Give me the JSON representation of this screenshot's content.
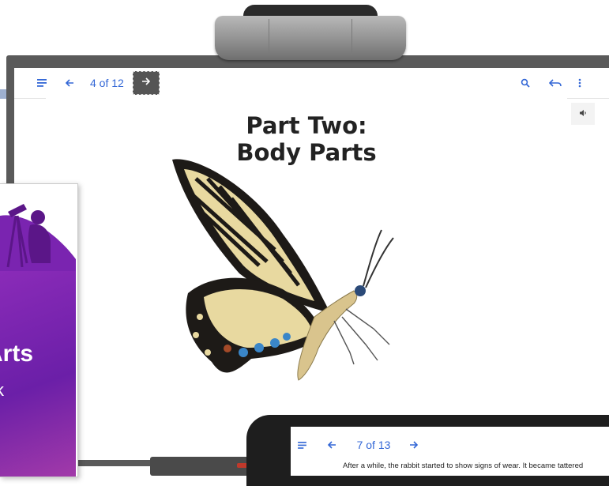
{
  "board_reader": {
    "page_indicator": "4 of 12",
    "page_title_line1": "Part Two:",
    "page_title_line2": "Body Parts",
    "icons": {
      "menu": "list-menu-icon",
      "back": "arrow-left-icon",
      "next": "arrow-right-icon",
      "search": "search-icon",
      "return": "return-arrow-icon",
      "more": "more-vert-icon",
      "audio": "speaker-icon"
    }
  },
  "book_cover": {
    "title": "Arts",
    "subtitle": "k"
  },
  "tablet_reader": {
    "page_indicator": "7 of 13",
    "body_text": "After a while, the rabbit started to show signs of wear. It became tattered"
  },
  "colors": {
    "accent": "#3367d6",
    "book_purple": "#7a24b0",
    "frame": "#5a5a5a"
  }
}
